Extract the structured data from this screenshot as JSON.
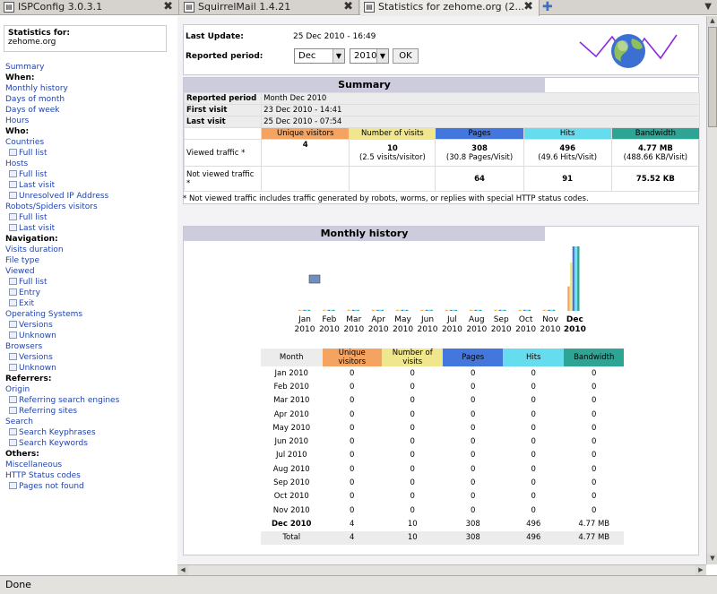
{
  "tabs": [
    {
      "label": "ISPConfig 3.0.3.1",
      "favicon": "ispconfig-icon"
    },
    {
      "label": "SquirrelMail 1.4.21",
      "favicon": "squirrelmail-icon"
    },
    {
      "label": "Statistics for zehome.org (2...",
      "favicon": "awstats-icon"
    }
  ],
  "menu": {
    "header_label": "Statistics for:",
    "header_domain": "zehome.org",
    "items": [
      {
        "text": "Summary",
        "type": "link"
      },
      {
        "text": "When:",
        "type": "head"
      },
      {
        "text": "Monthly history",
        "type": "link"
      },
      {
        "text": "Days of month",
        "type": "link"
      },
      {
        "text": "Days of week",
        "type": "link"
      },
      {
        "text": "Hours",
        "type": "link"
      },
      {
        "text": "Who:",
        "type": "head"
      },
      {
        "text": "Countries",
        "type": "link"
      },
      {
        "text": "Full list",
        "type": "sub"
      },
      {
        "text": "Hosts",
        "type": "link"
      },
      {
        "text": "Full list",
        "type": "sub"
      },
      {
        "text": "Last visit",
        "type": "sub"
      },
      {
        "text": "Unresolved IP Address",
        "type": "sub"
      },
      {
        "text": "Robots/Spiders visitors",
        "type": "link"
      },
      {
        "text": "Full list",
        "type": "sub"
      },
      {
        "text": "Last visit",
        "type": "sub"
      },
      {
        "text": "Navigation:",
        "type": "head"
      },
      {
        "text": "Visits duration",
        "type": "link"
      },
      {
        "text": "File type",
        "type": "link"
      },
      {
        "text": "Viewed",
        "type": "link"
      },
      {
        "text": "Full list",
        "type": "sub"
      },
      {
        "text": "Entry",
        "type": "sub"
      },
      {
        "text": "Exit",
        "type": "sub"
      },
      {
        "text": "Operating Systems",
        "type": "link"
      },
      {
        "text": "Versions",
        "type": "sub"
      },
      {
        "text": "Unknown",
        "type": "sub"
      },
      {
        "text": "Browsers",
        "type": "link"
      },
      {
        "text": "Versions",
        "type": "sub"
      },
      {
        "text": "Unknown",
        "type": "sub"
      },
      {
        "text": "Referrers:",
        "type": "head"
      },
      {
        "text": "Origin",
        "type": "link"
      },
      {
        "text": "Referring search engines",
        "type": "sub"
      },
      {
        "text": "Referring sites",
        "type": "sub"
      },
      {
        "text": "Search",
        "type": "link"
      },
      {
        "text": "Search Keyphrases",
        "type": "sub"
      },
      {
        "text": "Search Keywords",
        "type": "sub"
      },
      {
        "text": "Others:",
        "type": "head"
      },
      {
        "text": "Miscellaneous",
        "type": "link"
      },
      {
        "text": "HTTP Status codes",
        "type": "link"
      },
      {
        "text": "Pages not found",
        "type": "sub"
      }
    ]
  },
  "update": {
    "last_update_label": "Last Update:",
    "last_update_value": "25 Dec 2010 - 16:49",
    "period_label": "Reported period:",
    "month_select": "Dec",
    "year_select": "2010",
    "ok_label": "OK"
  },
  "summary": {
    "title": "Summary",
    "reported_period_label": "Reported period",
    "reported_period_value": "Month Dec 2010",
    "first_visit_label": "First visit",
    "first_visit_value": "23 Dec 2010 - 14:41",
    "last_visit_label": "Last visit",
    "last_visit_value": "25 Dec 2010 - 07:54",
    "col_headers": [
      "Unique visitors",
      "Number of visits",
      "Pages",
      "Hits",
      "Bandwidth"
    ],
    "viewed_label": "Viewed traffic *",
    "viewed": {
      "unique": "4",
      "visits": "10",
      "visits_sub": "(2.5 visits/visitor)",
      "pages": "308",
      "pages_sub": "(30.8 Pages/Visit)",
      "hits": "496",
      "hits_sub": "(49.6 Hits/Visit)",
      "bandwidth": "4.77 MB",
      "bandwidth_sub": "(488.66 KB/Visit)"
    },
    "not_viewed_label": "Not viewed traffic *",
    "not_viewed": {
      "pages": "64",
      "hits": "91",
      "bandwidth": "75.52 KB"
    },
    "note": "* Not viewed traffic includes traffic generated by robots, worms, or replies with special HTTP status codes."
  },
  "monthly": {
    "title": "Monthly history",
    "table_headers": [
      "Month",
      "Unique visitors",
      "Number of visits",
      "Pages",
      "Hits",
      "Bandwidth"
    ],
    "rows": [
      [
        "Jan 2010",
        "0",
        "0",
        "0",
        "0",
        "0"
      ],
      [
        "Feb 2010",
        "0",
        "0",
        "0",
        "0",
        "0"
      ],
      [
        "Mar 2010",
        "0",
        "0",
        "0",
        "0",
        "0"
      ],
      [
        "Apr 2010",
        "0",
        "0",
        "0",
        "0",
        "0"
      ],
      [
        "May 2010",
        "0",
        "0",
        "0",
        "0",
        "0"
      ],
      [
        "Jun 2010",
        "0",
        "0",
        "0",
        "0",
        "0"
      ],
      [
        "Jul 2010",
        "0",
        "0",
        "0",
        "0",
        "0"
      ],
      [
        "Aug 2010",
        "0",
        "0",
        "0",
        "0",
        "0"
      ],
      [
        "Sep 2010",
        "0",
        "0",
        "0",
        "0",
        "0"
      ],
      [
        "Oct 2010",
        "0",
        "0",
        "0",
        "0",
        "0"
      ],
      [
        "Nov 2010",
        "0",
        "0",
        "0",
        "0",
        "0"
      ],
      [
        "Dec 2010",
        "4",
        "10",
        "308",
        "496",
        "4.77 MB"
      ]
    ],
    "total": [
      "Total",
      "4",
      "10",
      "308",
      "496",
      "4.77 MB"
    ]
  },
  "chart_data": {
    "type": "bar",
    "categories": [
      "Jan 2010",
      "Feb 2010",
      "Mar 2010",
      "Apr 2010",
      "May 2010",
      "Jun 2010",
      "Jul 2010",
      "Aug 2010",
      "Sep 2010",
      "Oct 2010",
      "Nov 2010",
      "Dec 2010"
    ],
    "label_month": [
      "Jan",
      "Feb",
      "Mar",
      "Apr",
      "May",
      "Jun",
      "Jul",
      "Aug",
      "Sep",
      "Oct",
      "Nov",
      "Dec"
    ],
    "label_year": [
      "2010",
      "2010",
      "2010",
      "2010",
      "2010",
      "2010",
      "2010",
      "2010",
      "2010",
      "2010",
      "2010",
      "2010"
    ],
    "series": [
      {
        "name": "Unique visitors",
        "color": "#f4a460",
        "values": [
          0,
          0,
          0,
          0,
          0,
          0,
          0,
          0,
          0,
          0,
          0,
          4
        ]
      },
      {
        "name": "Number of visits",
        "color": "#f0e68c",
        "values": [
          0,
          0,
          0,
          0,
          0,
          0,
          0,
          0,
          0,
          0,
          0,
          10
        ]
      },
      {
        "name": "Pages",
        "color": "#4477dd",
        "values": [
          0,
          0,
          0,
          0,
          0,
          0,
          0,
          0,
          0,
          0,
          0,
          308
        ]
      },
      {
        "name": "Hits",
        "color": "#66ddee",
        "values": [
          0,
          0,
          0,
          0,
          0,
          0,
          0,
          0,
          0,
          0,
          0,
          496
        ]
      },
      {
        "name": "Bandwidth",
        "color": "#2ea495",
        "values": [
          0,
          0,
          0,
          0,
          0,
          0,
          0,
          0,
          0,
          0,
          0,
          4.77
        ]
      }
    ],
    "current_index": 11
  },
  "status": {
    "text": "Done"
  }
}
